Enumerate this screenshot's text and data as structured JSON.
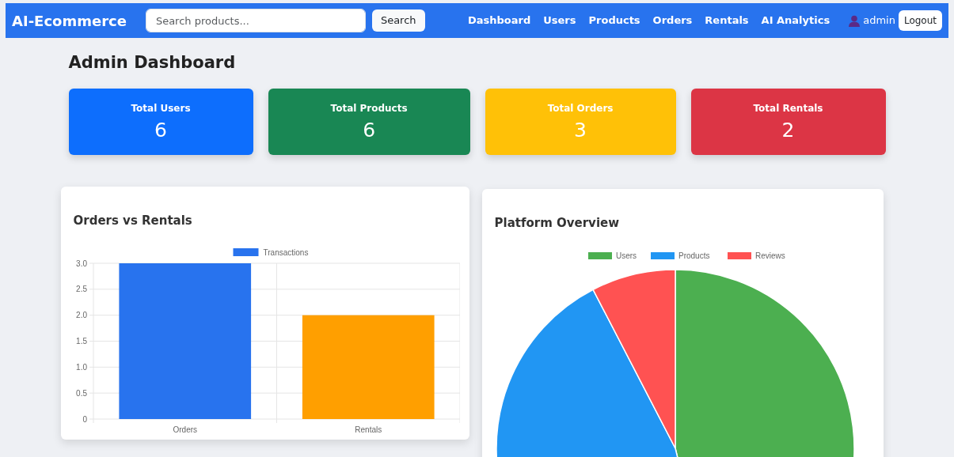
{
  "navbar": {
    "brand": "AI-Ecommerce",
    "search": {
      "placeholder": "Search products..."
    },
    "search_button": "Search",
    "links": [
      {
        "label": "Dashboard",
        "selected": false
      },
      {
        "label": "Users",
        "selected": false
      },
      {
        "label": "Products",
        "selected": false
      },
      {
        "label": "Orders",
        "selected": false
      },
      {
        "label": "Rentals",
        "selected": false
      },
      {
        "label": "AI Analytics",
        "selected": false
      }
    ],
    "user": "admin",
    "logout": "Logout"
  },
  "page_title": "Admin Dashboard",
  "stats": [
    {
      "label": "Total Users",
      "value": "6",
      "color": "#0d6efd"
    },
    {
      "label": "Total Products",
      "value": "6",
      "color": "#198754"
    },
    {
      "label": "Total Orders",
      "value": "3",
      "color": "#ffc107"
    },
    {
      "label": "Total Rentals",
      "value": "2",
      "color": "#dc3545"
    }
  ],
  "charts": [
    {
      "title": "Orders vs Rentals",
      "chart_data": {
        "type": "bar",
        "categories": [
          "Orders",
          "Rentals"
        ],
        "series": [
          {
            "name": "Transactions",
            "colors": [
              "#2873ee",
              "#ff9f00"
            ],
            "values": [
              3,
              2
            ]
          }
        ],
        "ylim": [
          0,
          3
        ],
        "yticks": [
          0,
          0.5,
          {
            "value": 1,
            "label": "1.0"
          },
          1.5,
          {
            "value": 2,
            "label": "2.0"
          },
          2.5,
          {
            "value": 3,
            "label": "3.0"
          }
        ],
        "grid": true,
        "legend": "top"
      }
    },
    {
      "title": "Platform Overview",
      "chart_data": {
        "type": "pie",
        "categories": [
          "Users",
          "Products",
          "Reviews"
        ],
        "values": [
          46.2,
          46.2,
          7.6
        ],
        "colors": [
          "#4caf50",
          "#2196f3",
          "#ff5252"
        ],
        "legend": "top"
      }
    }
  ]
}
